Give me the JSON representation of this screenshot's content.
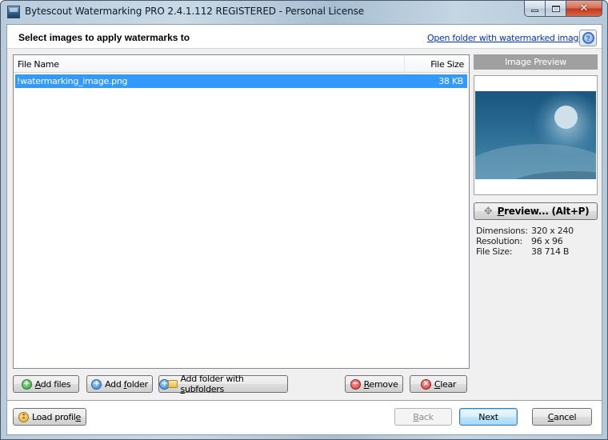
{
  "window": {
    "title": "Bytescout Watermarking PRO 2.4.1.112 REGISTERED - Personal License",
    "app_icon": "app-icon",
    "controls": {
      "minimize": "minimize-icon",
      "maximize": "maximize-icon",
      "close_glyph": "✕"
    }
  },
  "header": {
    "title": "Select images to apply watermarks to",
    "open_folder_link": "Open folder with watermarked images",
    "help_icon": "help-icon",
    "help_glyph": "?"
  },
  "file_list": {
    "columns": [
      "File Name",
      "File Size"
    ],
    "rows": [
      {
        "name": "!watermarking_image.png",
        "size": "38 KB",
        "selected": true
      }
    ],
    "selection_color": "#3399ff"
  },
  "list_buttons": {
    "add_files": {
      "pre": "",
      "u": "A",
      "post": "dd files",
      "icon": "add-green-icon",
      "glyph": "+"
    },
    "add_folder": {
      "pre": "Add ",
      "u": "f",
      "post": "older",
      "icon": "add-blue-icon",
      "glyph": "+"
    },
    "add_subfolders": {
      "pre": "Add folder with ",
      "u": "s",
      "post": "ubfolders",
      "icon": "add-folder-icon",
      "glyph": "+"
    },
    "remove": {
      "pre": "",
      "u": "R",
      "post": "emove",
      "icon": "remove-icon",
      "glyph": "−"
    },
    "clear": {
      "pre": "",
      "u": "C",
      "post": "lear",
      "icon": "clear-icon",
      "glyph": "×"
    }
  },
  "preview": {
    "header": "Image Preview",
    "button": {
      "pre": "",
      "u": "P",
      "post": "review... (Alt+P)",
      "icon_glyph": "✥"
    },
    "info": [
      {
        "label": "Dimensions:",
        "value": "320 x 240"
      },
      {
        "label": "Resolution:",
        "value": "96 x 96"
      },
      {
        "label": "File Size:",
        "value": "38 714 B"
      }
    ]
  },
  "footer": {
    "load_profile": {
      "pre": "Load profil",
      "u": "e",
      "post": "",
      "glyph": "⦂"
    },
    "back": {
      "pre": "",
      "u": "B",
      "post": "ack",
      "enabled": false
    },
    "next": {
      "label": "Next",
      "default": true
    },
    "cancel": {
      "pre": "",
      "u": "C",
      "post": "ancel"
    }
  }
}
